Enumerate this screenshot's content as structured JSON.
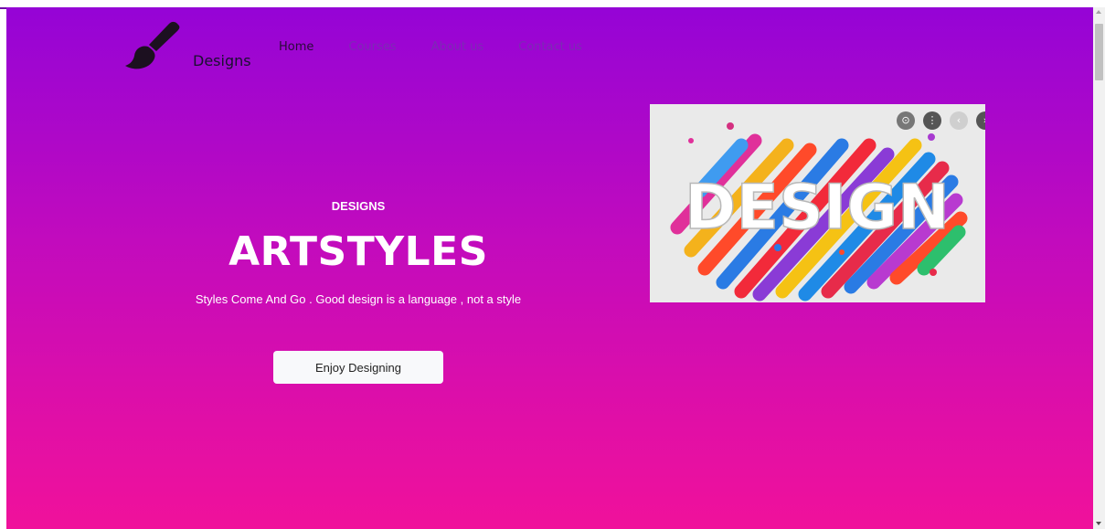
{
  "brand": {
    "name": "Designs",
    "logo_icon": "paintbrush-icon"
  },
  "nav": {
    "items": [
      {
        "label": "Home",
        "active": true
      },
      {
        "label": "Courses",
        "active": false
      },
      {
        "label": "About us",
        "active": false
      },
      {
        "label": "Contact us",
        "active": false
      }
    ]
  },
  "hero": {
    "kicker": "DESIGNS",
    "title": "ARTSTYLES",
    "subtitle": "Styles Come And Go . Good design is a language , not a style",
    "cta_label": "Enjoy Designing"
  },
  "image": {
    "text": "DESIGN",
    "controls": [
      "lens-icon",
      "more-vert-icon",
      "chevron-left-icon",
      "chevron-right-icon"
    ]
  },
  "colors": {
    "gradient_top": "#9504d6",
    "gradient_bottom": "#f0119b"
  }
}
